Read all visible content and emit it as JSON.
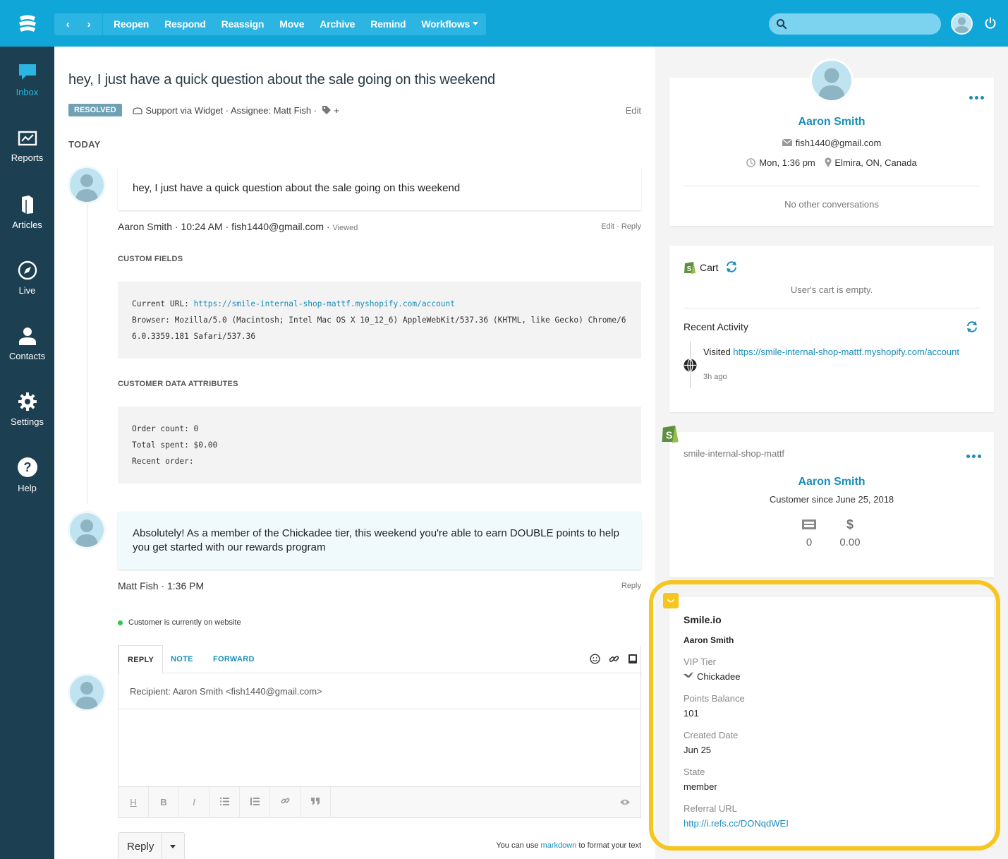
{
  "toolbar": {
    "buttons": [
      "Reopen",
      "Respond",
      "Reassign",
      "Move",
      "Archive",
      "Remind",
      "Workflows"
    ]
  },
  "sidebar": {
    "items": [
      {
        "label": "Inbox",
        "icon": "chat-bubble-icon",
        "active": true
      },
      {
        "label": "Reports",
        "icon": "chart-icon"
      },
      {
        "label": "Articles",
        "icon": "book-icon"
      },
      {
        "label": "Live",
        "icon": "compass-icon"
      },
      {
        "label": "Contacts",
        "icon": "person-icon"
      },
      {
        "label": "Settings",
        "icon": "gear-icon"
      },
      {
        "label": "Help",
        "icon": "help-icon"
      }
    ]
  },
  "conversation": {
    "subject": "hey, I just have a quick question about the sale going on this weekend",
    "status": "RESOLVED",
    "meta": "Support via Widget · Assignee: Matt Fish ·",
    "tag_add": "+",
    "edit": "Edit",
    "day": "TODAY",
    "messages": [
      {
        "text": "hey, I just have a quick question about the sale going on this weekend",
        "byline": "Aaron Smith · 10:24 AM · fish1440@gmail.com ·",
        "viewed": "Viewed",
        "actions": "Edit  ·  Reply"
      },
      {
        "text": "Absolutely! As a member of the Chickadee tier, this weekend you're able to earn DOUBLE points to help you get started with our rewards program",
        "byline": "Matt Fish · 1:36 PM",
        "actions": "Reply"
      }
    ],
    "custom_fields_title": "CUSTOM FIELDS",
    "current_url_label": "Current URL: ",
    "current_url": "https://smile-internal-shop-mattf.myshopify.com/account",
    "browser": "Browser: Mozilla/5.0 (Macintosh; Intel Mac OS X 10_12_6) AppleWebKit/537.36 (KHTML, like Gecko) Chrome/66.0.3359.181 Safari/537.36",
    "customer_data_title": "CUSTOMER DATA ATTRIBUTES",
    "customer_data": "Order count: 0\nTotal spent: $0.00\nRecent order:",
    "online_status": "Customer is currently on website"
  },
  "composer": {
    "tabs": [
      "REPLY",
      "NOTE",
      "FORWARD"
    ],
    "recipient": "Recipient: Aaron Smith <fish1440@gmail.com>",
    "reply_button": "Reply",
    "markdown_pre": "You can use ",
    "markdown_link": "markdown",
    "markdown_post": " to format your text",
    "format_buttons": [
      "H",
      "B",
      "I"
    ]
  },
  "customer": {
    "name": "Aaron Smith",
    "email": "fish1440@gmail.com",
    "local_time": "Mon, 1:36 pm",
    "location": "Elmira, ON, Canada",
    "other_conversations": "No other conversations"
  },
  "cart": {
    "title": "Cart",
    "empty": "User's cart is empty.",
    "activity_title": "Recent Activity",
    "visited_label": "Visited ",
    "visited_url": "https://smile-internal-shop-mattf.myshopify.com/account",
    "visited_ago": "3h ago"
  },
  "shopify": {
    "store": "smile-internal-shop-mattf",
    "name": "Aaron Smith",
    "since": "Customer since June 25, 2018",
    "orders": "0",
    "currency_symbol": "$",
    "spent": "0.00"
  },
  "smile": {
    "title": "Smile.io",
    "name": "Aaron Smith",
    "vip_label": "VIP Tier",
    "vip_value": "Chickadee",
    "points_label": "Points Balance",
    "points_value": "101",
    "created_label": "Created Date",
    "created_value": "Jun 25",
    "state_label": "State",
    "state_value": "member",
    "referral_label": "Referral URL",
    "referral_value": "http://i.refs.cc/DONqdWEI"
  },
  "colors": {
    "topbar": "#11a6d8",
    "sidebar": "#1d3f52",
    "link": "#1a8db8",
    "highlight": "#f6c51e",
    "badge": "#6fa0b4"
  }
}
